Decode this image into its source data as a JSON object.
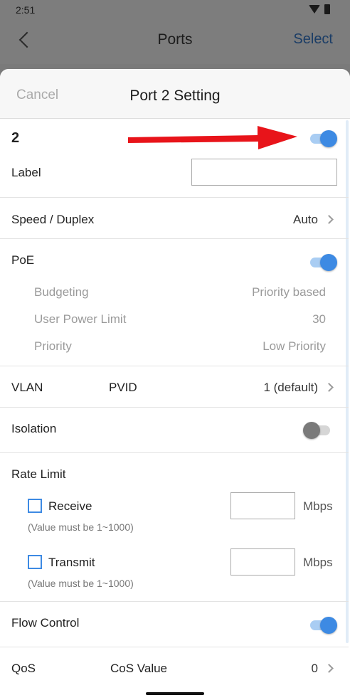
{
  "status_bar": {
    "time": "2:51",
    "icons": [
      "wifi-icon",
      "battery-icon"
    ]
  },
  "top_bar": {
    "title": "Ports",
    "select_label": "Select",
    "back_icon": "chevron-left-icon"
  },
  "sheet": {
    "cancel_label": "Cancel",
    "title": "Port 2 Setting",
    "port_number": "2",
    "port_enabled": true,
    "label_field": {
      "label": "Label",
      "value": ""
    },
    "speed_duplex": {
      "label": "Speed / Duplex",
      "value": "Auto"
    },
    "poe": {
      "label": "PoE",
      "enabled": true,
      "budgeting": {
        "label": "Budgeting",
        "value": "Priority based"
      },
      "user_power_limit": {
        "label": "User Power Limit",
        "value": "30"
      },
      "priority": {
        "label": "Priority",
        "value": "Low Priority"
      }
    },
    "vlan": {
      "label": "VLAN",
      "pvid_label": "PVID",
      "value": "1 (default)"
    },
    "isolation": {
      "label": "Isolation",
      "enabled": false
    },
    "rate_limit": {
      "label": "Rate Limit",
      "receive": {
        "label": "Receive",
        "checked": false,
        "value": "",
        "unit": "Mbps",
        "note": "(Value must be 1~1000)"
      },
      "transmit": {
        "label": "Transmit",
        "checked": false,
        "value": "",
        "unit": "Mbps",
        "note": "(Value must be 1~1000)"
      }
    },
    "flow_control": {
      "label": "Flow Control",
      "enabled": true
    },
    "qos": {
      "label": "QoS",
      "cos_label": "CoS Value",
      "value": "0"
    }
  },
  "colors": {
    "accent": "#3d8ae3",
    "accent_light": "#a9cdf3",
    "arrow": "#e8141a",
    "select_text": "#1b3d66"
  }
}
